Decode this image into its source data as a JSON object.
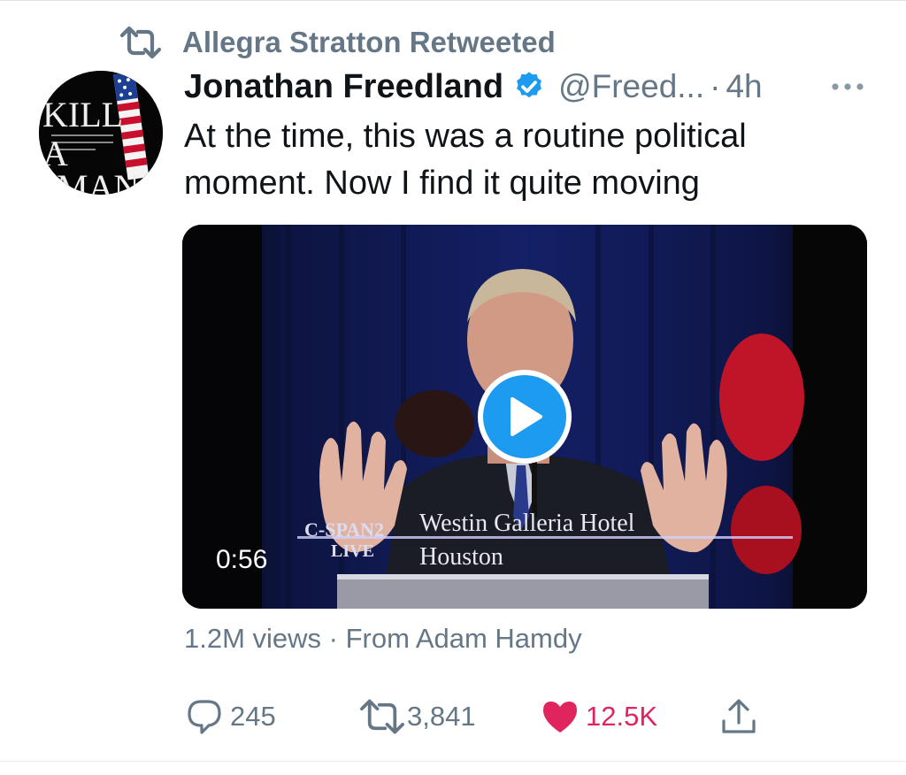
{
  "retweet_context": {
    "text": "Allegra Stratton Retweeted",
    "icon": "retweet-icon"
  },
  "author": {
    "name": "Jonathan Freedland",
    "handle": "@Freed...",
    "verified": true,
    "verified_icon": "verified-badge-icon",
    "time_separator": "·",
    "time": "4h",
    "avatar_text": [
      "KILL",
      "A",
      "MAN"
    ]
  },
  "tweet": {
    "text": "At the time, this was a routine political moment. Now I find it quite moving"
  },
  "video": {
    "duration": "0:56",
    "caption_line1": "Westin Galleria Hotel",
    "caption_line2": "Houston",
    "network": "C-SPAN2",
    "live": "LIVE",
    "play_icon": "play-icon"
  },
  "meta": {
    "views_text": "1.2M views · From Adam Hamdy"
  },
  "actions": {
    "replies": "245",
    "retweets": "3,841",
    "likes": "12.5K"
  },
  "colors": {
    "secondary_text": "#657786",
    "accent_blue": "#1d9bf0",
    "like_red": "#e0245e"
  }
}
